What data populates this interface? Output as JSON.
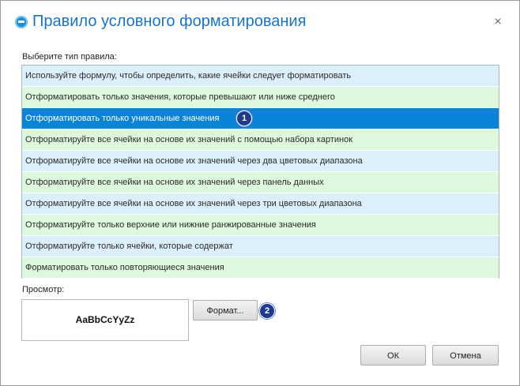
{
  "window": {
    "title": "Правило условного форматирования",
    "app_icon": "app-logo-icon",
    "close_glyph": "×"
  },
  "rule_type": {
    "label": "Выберите тип правила:",
    "items": [
      {
        "label": "Используйте формулу, чтобы определить, какие ячейки следует форматировать",
        "tone": "blue"
      },
      {
        "label": "Отформатировать только значения, которые превышают или ниже среднего",
        "tone": "green"
      },
      {
        "label": "Отформатировать только уникальные значения",
        "tone": "selected",
        "badge": "1"
      },
      {
        "label": "Отформатируйте все ячейки на основе их значений с помощью набора картинок",
        "tone": "green"
      },
      {
        "label": "Отформатируйте все ячейки на основе их значений через два цветовых диапазона",
        "tone": "blue"
      },
      {
        "label": "Отформатируйте все ячейки на основе их значений через панель данных",
        "tone": "green"
      },
      {
        "label": "Отформатируйте все ячейки на основе их значений через три цветовых диапазона",
        "tone": "blue"
      },
      {
        "label": "Отформатируйте только верхние или нижние ранжированные значения",
        "tone": "green"
      },
      {
        "label": "Отформатируйте только ячейки, которые содержат",
        "tone": "blue"
      },
      {
        "label": "Форматировать только повторяющиеся значения",
        "tone": "green"
      }
    ],
    "selected_index": 2
  },
  "preview": {
    "label": "Просмотр:",
    "sample_text": "AaBbCcYyZz",
    "format_button": "Формат...",
    "format_badge": "2"
  },
  "buttons": {
    "ok": "ОК",
    "cancel": "Отмена"
  },
  "colors": {
    "title": "#1a73c7",
    "selected_row": "#0a84d8",
    "row_blue": "#dcf0fc",
    "row_green": "#ddf8dd",
    "badge": "#1f3a8f"
  }
}
